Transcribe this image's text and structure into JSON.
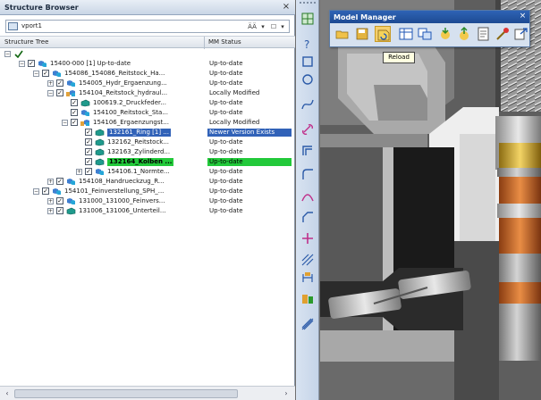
{
  "structure_browser": {
    "title": "Structure Browser",
    "close_glyph": "×",
    "combo": {
      "value": "vport1",
      "tool_find": "ÄÄ",
      "tool_dropdown": "▾",
      "tool_options": "☐"
    },
    "columns": {
      "tree": "Structure Tree",
      "status": "MM Status"
    },
    "rows": [
      {
        "label": "",
        "status": ""
      },
      {
        "label": "15400-000 [1] Up-to-date",
        "status": "Up-to-date"
      },
      {
        "label": "154086_154086_Reitstock_Ha...",
        "status": "Up-to-date"
      },
      {
        "label": "154005_Hydr_Ergaenzung...",
        "status": "Up-to-date"
      },
      {
        "label": "154104_Reitstock_hydraul...",
        "status": "Locally Modified"
      },
      {
        "label": "100619.2_Druckfeder...",
        "status": "Up-to-date"
      },
      {
        "label": "154100_Reitstock_Sta...",
        "status": "Up-to-date"
      },
      {
        "label": "154106_Ergaenzungst...",
        "status": "Locally Modified"
      },
      {
        "label": "132161_Ring [1] ...",
        "status": "Newer Version Exists"
      },
      {
        "label": "132162_Reitstock...",
        "status": "Up-to-date"
      },
      {
        "label": "132163_Zylinderd...",
        "status": "Up-to-date"
      },
      {
        "label": "132164_Kolben ...",
        "status": "Up-to-date"
      },
      {
        "label": "154106.1_Normte...",
        "status": "Up-to-date"
      },
      {
        "label": "154108_Handrueckzug_R...",
        "status": "Up-to-date"
      },
      {
        "label": "154101_Feinverstellung_SPH_...",
        "status": "Up-to-date"
      },
      {
        "label": "131000_131000_Feinvers...",
        "status": "Up-to-date"
      },
      {
        "label": "131006_131006_Unterteil...",
        "status": "Up-to-date"
      }
    ],
    "scroll_left": "‹",
    "scroll_right": "›"
  },
  "model_manager": {
    "title": "Model Manager",
    "close_glyph": "×",
    "tooltip": "Reload",
    "buttons": [
      "open-icon",
      "save-icon",
      "reload-icon",
      "table-icon",
      "compare-icon",
      "check-in-icon",
      "check-out-icon",
      "info-icon",
      "release-icon",
      "export-icon"
    ]
  },
  "toolbar": {
    "buttons": [
      "grid-icon",
      "question-icon",
      "rectangle-icon",
      "circle-icon",
      "spline-icon",
      "link-icon",
      "offset-icon",
      "fillet-icon",
      "arc-icon",
      "chamfer-icon",
      "cross-icon",
      "hatch-icon",
      "dimension-icon",
      "parts-icon",
      "pattern-icon"
    ]
  },
  "colors": {
    "selected_blue": "#3162b8",
    "selected_green": "#22c93a",
    "title_blue": "#2e63b5"
  }
}
